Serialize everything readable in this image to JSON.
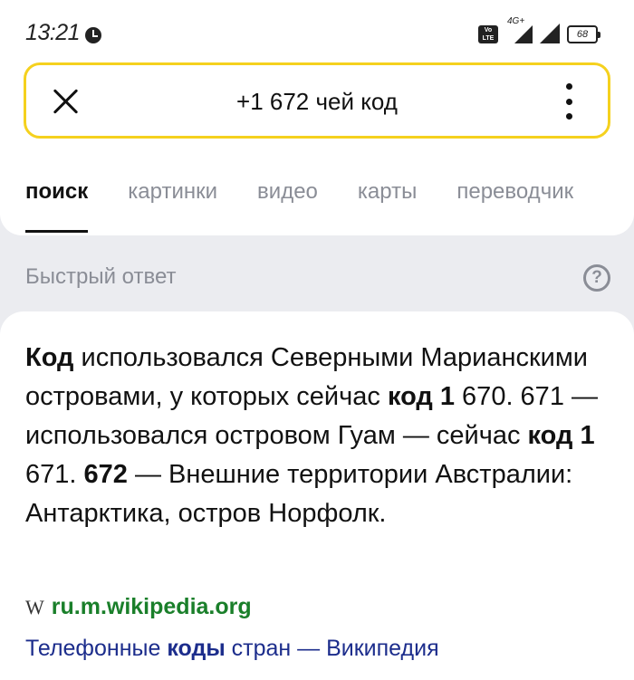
{
  "status_bar": {
    "time": "13:21",
    "network_type": "4G+",
    "volte_label": "Vo LTE",
    "battery": "68"
  },
  "search": {
    "query": "+1 672 чей код"
  },
  "tabs": [
    {
      "label": "поиск",
      "active": true
    },
    {
      "label": "картинки",
      "active": false
    },
    {
      "label": "видео",
      "active": false
    },
    {
      "label": "карты",
      "active": false
    },
    {
      "label": "переводчик",
      "active": false
    }
  ],
  "quick_answer": {
    "title": "Быстрый ответ",
    "help_glyph": "?",
    "text_segments": [
      {
        "text": "Код",
        "bold": true
      },
      {
        "text": " использовался Северными Марианскими островами, у которых сейчас ",
        "bold": false
      },
      {
        "text": "код 1",
        "bold": true
      },
      {
        "text": " 670. 671 — использовался островом Гуам — сейчас ",
        "bold": false
      },
      {
        "text": "код 1",
        "bold": true
      },
      {
        "text": " 671. ",
        "bold": false
      },
      {
        "text": "672",
        "bold": true
      },
      {
        "text": " — Внешние территории Австралии: Антарктика, остров Норфолк.",
        "bold": false
      }
    ],
    "source_icon_glyph": "W",
    "source_domain": "ru.m.wikipedia.org",
    "link_parts": {
      "before": "Телефонные ",
      "bold": "коды",
      "after": " стран — Википедия"
    }
  },
  "colors": {
    "search_border": "#f5d11e",
    "domain_green": "#1a7f2a",
    "link_blue": "#1c2d8c",
    "muted_gray": "#8a8d96"
  }
}
